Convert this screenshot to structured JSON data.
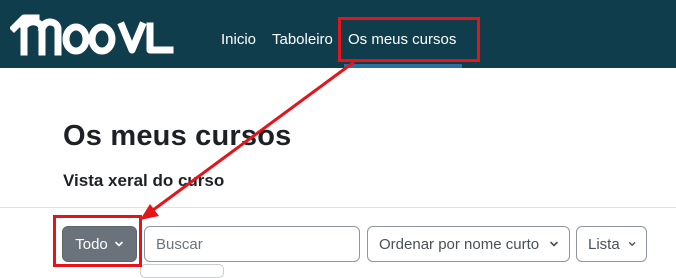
{
  "header": {
    "logo_text": "moodle",
    "nav": [
      {
        "label": "Inicio"
      },
      {
        "label": "Taboleiro"
      },
      {
        "label": "Os meus cursos",
        "active": true
      }
    ]
  },
  "page": {
    "title": "Os meus cursos",
    "subtitle": "Vista xeral do curso"
  },
  "filters": {
    "grouping_label": "Todo",
    "search_placeholder": "Buscar",
    "sort_label": "Ordenar por nome curto",
    "view_label": "Lista"
  },
  "colors": {
    "header_bg": "#0f3d4c",
    "annotation": "#e5141b",
    "button_bg": "#6a737b"
  },
  "icons": {
    "dropdown": "chevron-down-icon"
  }
}
